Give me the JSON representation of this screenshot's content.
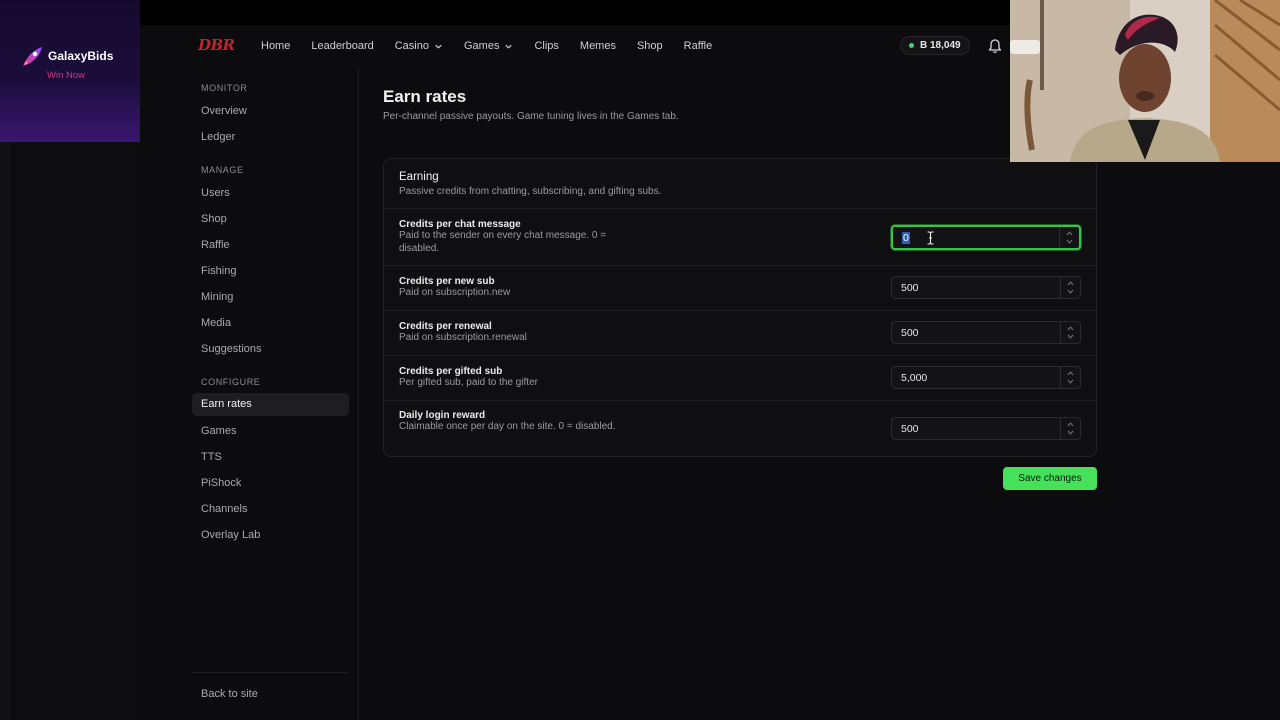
{
  "ad": {
    "brand": "GalaxyBids",
    "cta": "Win Now"
  },
  "nav": {
    "logo": "DBR",
    "links": [
      {
        "label": "Home"
      },
      {
        "label": "Leaderboard"
      },
      {
        "label": "Casino"
      },
      {
        "label": "Games"
      },
      {
        "label": "Clips"
      },
      {
        "label": "Memes"
      },
      {
        "label": "Shop"
      },
      {
        "label": "Raffle"
      }
    ],
    "balance": "B 18,049"
  },
  "sidebar": {
    "monitor_heading": "MONITOR",
    "monitor": [
      "Overview",
      "Ledger"
    ],
    "manage_heading": "MANAGE",
    "manage": [
      "Users",
      "Shop",
      "Raffle",
      "Fishing",
      "Mining",
      "Media",
      "Suggestions"
    ],
    "configure_heading": "CONFIGURE",
    "configure": [
      "Earn rates",
      "Games",
      "TTS",
      "PiShock",
      "Channels",
      "Overlay Lab"
    ],
    "active_item": "Earn rates",
    "back_link": "Back to site"
  },
  "main": {
    "title": "Earn rates",
    "subtitle": "Per-channel passive payouts. Game tuning lives in the Games tab.",
    "card": {
      "title": "Earning",
      "desc": "Passive credits from chatting, subscribing, and gifting subs.",
      "rows": [
        {
          "label": "Credits per chat message",
          "desc": "Paid to the sender on every chat message. 0 = disabled.",
          "value": "0"
        },
        {
          "label": "Credits per new sub",
          "desc": "Paid on subscription.new",
          "value": "500"
        },
        {
          "label": "Credits per renewal",
          "desc": "Paid on subscription.renewal",
          "value": "500"
        },
        {
          "label": "Credits per gifted sub",
          "desc": "Per gifted sub, paid to the gifter",
          "value": "5,000"
        },
        {
          "label": "Daily login reward",
          "desc": "Claimable once per day on the site. 0 = disabled.",
          "value": "500"
        }
      ]
    },
    "save_label": "Save changes"
  },
  "colors": {
    "accent_green": "#46e05b",
    "focus_ring": "#3cc24a",
    "logo_red": "#c0232b",
    "ad_cta": "#d5337e"
  }
}
